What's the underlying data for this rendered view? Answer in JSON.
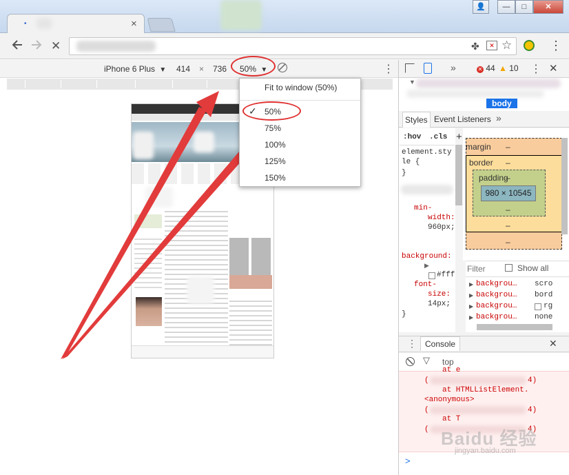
{
  "window": {
    "close_label": "✕",
    "maximize_label": "□",
    "minimize_label": "—",
    "user_label": "👤"
  },
  "browser": {
    "tab_close": "×",
    "back_icon": "back-arrow-icon",
    "forward_icon": "forward-arrow-icon",
    "stop_icon": "✕",
    "bookmark_star": "☆",
    "menu_dots": "⋮"
  },
  "device_toolbar": {
    "device": "iPhone 6 Plus",
    "width": "414",
    "times": "×",
    "height": "736",
    "zoom": "50%",
    "dropdown_arrow": "▼"
  },
  "zoom_menu": {
    "items": [
      {
        "label": "Fit to window (50%)",
        "checked": false
      },
      {
        "label": "50%",
        "checked": true
      },
      {
        "label": "75%",
        "checked": false
      },
      {
        "label": "100%",
        "checked": false
      },
      {
        "label": "125%",
        "checked": false
      },
      {
        "label": "150%",
        "checked": false
      }
    ],
    "check": "✓"
  },
  "devtools": {
    "more_tabs": "»",
    "errors": "44",
    "warnings": "10",
    "body_tag": "body",
    "tabs": {
      "styles": "Styles",
      "event_listeners": "Event Listeners",
      "more": "»"
    },
    "hov": ":hov",
    "cls": ".cls",
    "plus": "+",
    "styles_lines": [
      "element.sty",
      "le {",
      "}"
    ],
    "prop_lines": [
      {
        "text": "min-",
        "kind": "prop"
      },
      {
        "text": "width:",
        "kind": "prop"
      },
      {
        "text": "960px;",
        "kind": "val"
      }
    ],
    "background_line": "background:",
    "bg_value": "#fff",
    "font_lines": [
      {
        "text": "font-",
        "kind": "prop"
      },
      {
        "text": "size:",
        "kind": "prop"
      },
      {
        "text": "14px;",
        "kind": "val"
      }
    ],
    "brace_close": "}",
    "box_model": {
      "margin": "margin",
      "border": "border",
      "padding": "padding",
      "content": "980 × 10545",
      "dash": "–"
    },
    "filter_placeholder": "Filter",
    "show_all": "Show all",
    "computed": [
      {
        "name": "backgrou…",
        "value": "scro"
      },
      {
        "name": "backgrou…",
        "value": "bord"
      },
      {
        "name": "backgrou…",
        "value": "rg"
      },
      {
        "name": "backgrou…",
        "value": "none"
      }
    ],
    "console": {
      "title": "Console",
      "context": "top",
      "lines": [
        "at e",
        "4)",
        "at HTMLListElement.",
        "<anonymous>",
        "4)",
        "at T",
        "4)"
      ],
      "prompt": ">"
    }
  },
  "watermark": {
    "brand": "Baidu 经验",
    "url": "jingyan.baidu.com"
  }
}
